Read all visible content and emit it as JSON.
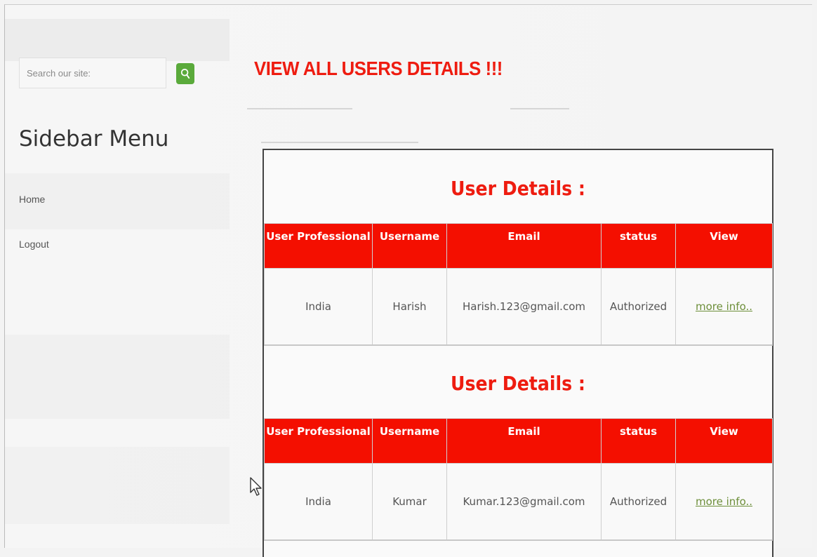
{
  "page": {
    "title": "VIEW ALL USERS DETAILS !!!"
  },
  "sidebar": {
    "search_placeholder": "Search our site:",
    "search_icon": "search-icon",
    "title": "Sidebar Menu",
    "items": [
      {
        "label": "Home"
      },
      {
        "label": "Logout"
      }
    ]
  },
  "colors": {
    "heading_red": "#ee1c10",
    "header_red": "#f40f00",
    "search_green": "#5aaa3b",
    "link_green": "#6d8f3a"
  },
  "users": [
    {
      "heading": "User Details :",
      "columns": [
        "User Professional",
        "Username",
        "Email",
        "status",
        "View"
      ],
      "row": {
        "professional": "India",
        "username": "Harish",
        "email": "Harish.123@gmail.com",
        "status": "Authorized",
        "view": "more info.."
      }
    },
    {
      "heading": "User Details :",
      "columns": [
        "User Professional",
        "Username",
        "Email",
        "status",
        "View"
      ],
      "row": {
        "professional": "India",
        "username": "Kumar",
        "email": "Kumar.123@gmail.com",
        "status": "Authorized",
        "view": "more info.."
      }
    }
  ]
}
